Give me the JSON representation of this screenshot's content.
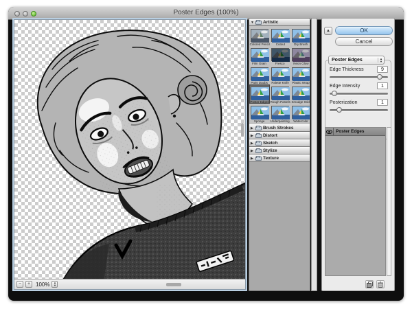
{
  "window": {
    "title": "Poster Edges (100%)"
  },
  "preview": {
    "zoom_out_label": "−",
    "zoom_in_label": "+",
    "zoom_level": "100%"
  },
  "filter_panel": {
    "categories": [
      {
        "name": "Artistic",
        "expanded": true,
        "selected": "Poster Edges",
        "filters": [
          "Colored Pencil",
          "Cutout",
          "Dry Brush",
          "Film Grain",
          "Fresco",
          "Neon Glow",
          "Paint Daubs",
          "Palette Knife",
          "Plastic Wrap",
          "Poster Edges",
          "Rough Pastels",
          "Smudge Stick",
          "Sponge",
          "Underpainting",
          "Watercolor"
        ],
        "thumb_variants": {
          "Colored Pencil": "v-muted",
          "Fresco": "v-dark",
          "Neon Glow": "v-purple"
        }
      },
      {
        "name": "Brush Strokes",
        "expanded": false
      },
      {
        "name": "Distort",
        "expanded": false
      },
      {
        "name": "Sketch",
        "expanded": false
      },
      {
        "name": "Stylize",
        "expanded": false
      },
      {
        "name": "Texture",
        "expanded": false
      }
    ]
  },
  "controls": {
    "ok_label": "OK",
    "cancel_label": "Cancel",
    "filter_select": "Poster Edges",
    "sliders": [
      {
        "label": "Edge Thickness",
        "value": "9",
        "percent": 86
      },
      {
        "label": "Edge Intensity",
        "value": "1",
        "percent": 8
      },
      {
        "label": "Posterization",
        "value": "1",
        "percent": 16
      }
    ]
  },
  "effect_layers": {
    "items": [
      {
        "name": "Poster Edges",
        "visible": true
      }
    ]
  },
  "colors": {
    "ok_button_blue": "#96c5ee",
    "window_body": "#0e0e0e",
    "panel_gray": "#ebebeb",
    "thumb_panel_gray": "#a9a9a9",
    "selected_thumb": "#8b8b8b",
    "traffic_green": "#52b61f"
  }
}
